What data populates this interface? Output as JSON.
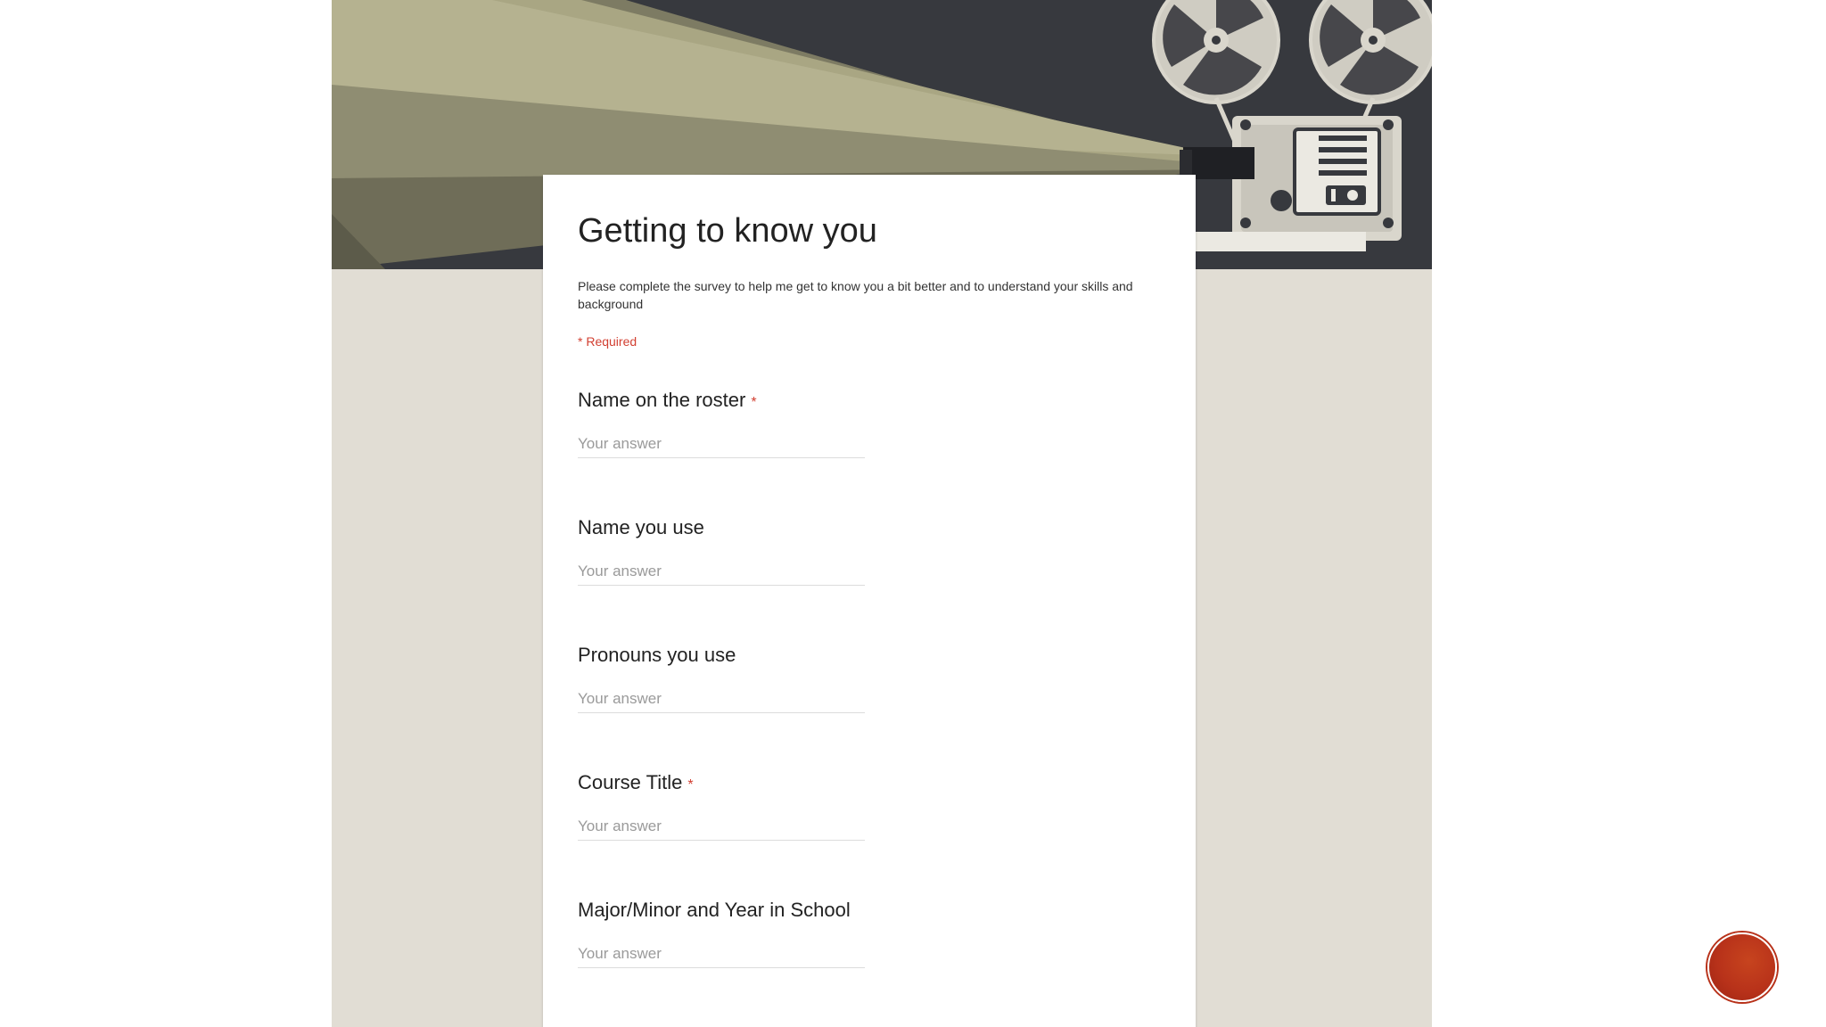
{
  "form": {
    "title": "Getting to know you",
    "description": "Please complete the survey to help me get to know you a bit better and to understand your skills and background",
    "required_note": "* Required",
    "questions": [
      {
        "label": "Name on the roster",
        "required_mark": "*",
        "placeholder": "Your answer"
      },
      {
        "label": "Name you use",
        "required_mark": "",
        "placeholder": "Your answer"
      },
      {
        "label": "Pronouns you use",
        "required_mark": "",
        "placeholder": "Your answer"
      },
      {
        "label": "Course Title",
        "required_mark": "*",
        "placeholder": "Your answer"
      },
      {
        "label": "Major/Minor and Year in School",
        "required_mark": "",
        "placeholder": "Your answer"
      }
    ]
  },
  "colors": {
    "banner_dark": "#37393e",
    "banner_beam": "#a9a683",
    "page_background": "#e1ddd4",
    "required_red": "#d23f31",
    "logo_red": "#b8321a"
  },
  "icons": {
    "header_image": "film-projector-icon",
    "corner_logo": "red-circle-logo"
  }
}
